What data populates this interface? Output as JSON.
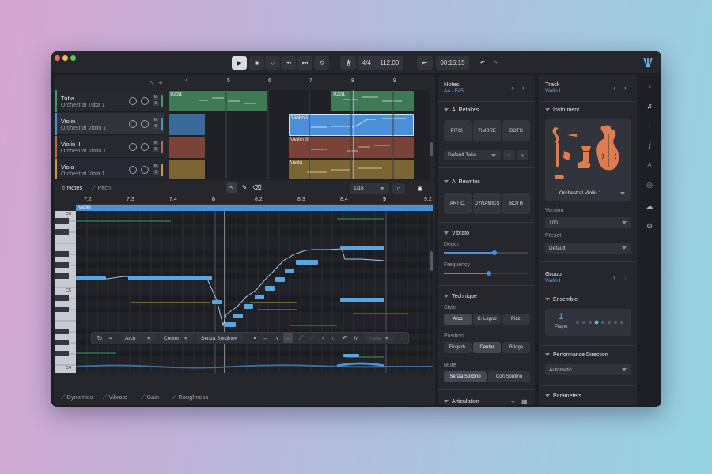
{
  "colors": {
    "accent": "#4a90d9",
    "tuba": "#3e7a56",
    "violin1": "#3f74a6",
    "violin2": "#8a4a3c",
    "viola": "#8a7238"
  },
  "transport": {
    "play": "▶",
    "stop": "■",
    "record": "○",
    "rewind": "⏮",
    "forward": "⏭",
    "loop": "⟲",
    "metronome": "metronome-icon",
    "signature": "4/4",
    "tempo": "112.00",
    "time": "00:15:15",
    "undo": "↶",
    "redo": "↷",
    "return": "⇤"
  },
  "tracks": [
    {
      "name": "Tuba",
      "instrument": "Orchestral Tuba 1",
      "color": "#3e9a6a"
    },
    {
      "name": "Violin I",
      "instrument": "Orchestral Violin 1",
      "color": "#4a90d9"
    },
    {
      "name": "Violin II",
      "instrument": "Orchestral Violin 1",
      "color": "#c2614c"
    },
    {
      "name": "Viola",
      "instrument": "Orchestral Viola 1",
      "color": "#c99a3a"
    }
  ],
  "arrangement": {
    "bars": [
      "4",
      "5",
      "6",
      "7",
      "8",
      "9"
    ],
    "clips": {
      "tuba1": "Tuba",
      "tuba2": "Tuba",
      "violin1": "Violin I",
      "violin2": "Violin II",
      "viola": "Viola"
    }
  },
  "tabs": {
    "notes": "Notes",
    "pitch": "Pitch"
  },
  "editor": {
    "quantize": "1/16",
    "ruler": [
      "7.2",
      "7.3",
      "7.4",
      "8",
      "8.2",
      "8.3",
      "8.4",
      "9",
      "9.2"
    ],
    "region": "Violin I",
    "keys": {
      "c6": "C6",
      "c5": "C5",
      "c4": "C4"
    }
  },
  "toolbar": {
    "artic": "Arco",
    "position": "Center",
    "mute": "Senza Sordino",
    "tr": "tr",
    "none": "none"
  },
  "bottom_tabs": [
    "Dynamics",
    "Vibrato",
    "Gain",
    "Roughness"
  ],
  "notes_panel": {
    "title": "Notes",
    "range": "A4 - F#5",
    "retakes": {
      "title": "AI Retakes",
      "pitch": "PITCH",
      "timbre": "TIMBRE",
      "both": "BOTH",
      "take": "Default Take"
    },
    "rewrites": {
      "title": "AI Rewrites",
      "artic": "ARTIC.",
      "dynamics": "DYNAMICS",
      "both": "BOTH"
    },
    "vibrato": {
      "title": "Vibrato",
      "depth": "Depth",
      "frequency": "Frequency",
      "depth_value": 0.6,
      "frequency_value": 0.53
    },
    "technique": {
      "title": "Technique",
      "style": "Style",
      "styles": [
        "Arco",
        "C. Legno",
        "Pizz."
      ],
      "position": "Position",
      "positions": [
        "Fingerb.",
        "Center",
        "Bridge"
      ],
      "mute": "Mute",
      "mutes": [
        "Senza Sordino",
        "Con Sordino"
      ]
    },
    "articulation": {
      "title": "Articulation"
    }
  },
  "track_panel": {
    "title": "Track",
    "name": "Violin I",
    "instrument_title": "Instrument",
    "instrument": "Orchestral Violin 1",
    "version_label": "Version",
    "version": "100",
    "preset_label": "Preset",
    "preset": "Default",
    "group_title": "Group",
    "group": "Violin I",
    "ensemble_title": "Ensemble",
    "players": "1",
    "player_label": "Player",
    "perf_title": "Performance Direction",
    "perf": "Automatic",
    "params_title": "Parameters"
  },
  "sidebar_icons": [
    "violin-icon",
    "music-note-icon",
    "mixer-icon",
    "fx-icon",
    "stand-icon",
    "eye-icon",
    "cloud-icon",
    "gear-icon"
  ]
}
